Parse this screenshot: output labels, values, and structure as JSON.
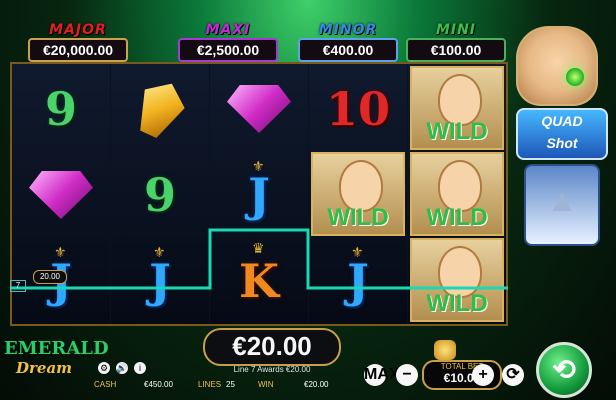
{
  "jackpots": {
    "major": {
      "label": "MAJOR",
      "value": "€20,000.00"
    },
    "maxi": {
      "label": "MAXI",
      "value": "€2,500.00"
    },
    "minor": {
      "label": "MINOR",
      "value": "€400.00"
    },
    "mini": {
      "label": "MINI",
      "value": "€100.00"
    }
  },
  "reels": {
    "r1": [
      "9",
      "gem-pink",
      "J"
    ],
    "r2": [
      "gem-yellow",
      "9",
      "J"
    ],
    "r3": [
      "gem-pink",
      "J",
      "K"
    ],
    "r4": [
      "10",
      "WILD",
      "J"
    ],
    "r5": [
      "WILD",
      "WILD",
      "WILD"
    ]
  },
  "payline": {
    "line_number": "7",
    "marker_value": "20.00"
  },
  "quad_shot": {
    "title": "QUAD",
    "subtitle": "Shot"
  },
  "win": {
    "value": "€20.00",
    "award_text": "Line 7 Awards €20.00"
  },
  "brand": {
    "line1": "EMERALD",
    "line2": "Dream"
  },
  "status": {
    "cash_label": "CASH",
    "cash_value": "€450.00",
    "lines_label": "LINES",
    "lines_value": "25",
    "win_label": "WIN",
    "win_value": "€20.00"
  },
  "bet": {
    "label": "TOTAL BET",
    "value": "€10.00"
  },
  "buttons": {
    "max": "MAX",
    "minus": "−",
    "plus": "+",
    "auto": "⟳",
    "spin": "⟲"
  },
  "colors": {
    "accent_gold": "#c79f49",
    "win_green": "#1ec56b",
    "payline": "#18d9b3"
  }
}
